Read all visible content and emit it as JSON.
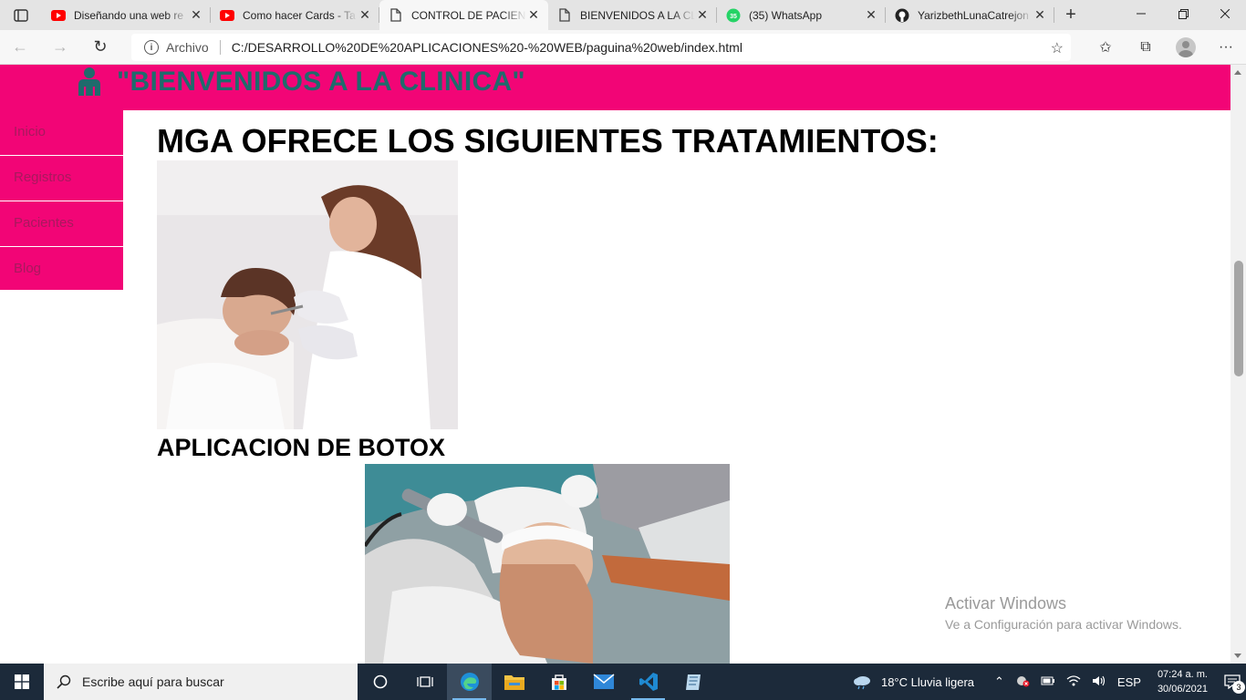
{
  "browser": {
    "tabs": [
      {
        "title": "Diseñando una web re",
        "favicon": "youtube-icon",
        "active": false
      },
      {
        "title": "Como hacer Cards - Ta",
        "favicon": "youtube-icon",
        "active": false
      },
      {
        "title": "CONTROL DE PACIENT",
        "favicon": "document-icon",
        "active": true
      },
      {
        "title": "BIENVENIDOS A LA CL",
        "favicon": "document-icon",
        "active": false
      },
      {
        "title": "(35) WhatsApp",
        "favicon": "whatsapp-icon",
        "active": false
      },
      {
        "title": "YarizbethLunaCatrejon",
        "favicon": "github-icon",
        "active": false
      }
    ],
    "whatsapp_badge": "35",
    "address": {
      "scheme_label": "Archivo",
      "url": "C:/DESARROLLO%20DE%20APLICACIONES%20-%20WEB/paguina%20web/index.html"
    }
  },
  "page": {
    "site_title": "\"BIENVENIDOS A LA CLINICA\"",
    "nav": [
      {
        "label": "Inicio"
      },
      {
        "label": "Registros"
      },
      {
        "label": "Pacientes"
      },
      {
        "label": "Blog"
      }
    ],
    "heading": "MGA OFRECE LOS SIGUIENTES TRATAMIENTOS:",
    "treatments": [
      {
        "caption": "APLICACION DE BOTOX"
      }
    ],
    "watermark": {
      "line1": "Activar Windows",
      "line2": "Ve a Configuración para activar Windows."
    }
  },
  "taskbar": {
    "search_placeholder": "Escribe aquí para buscar",
    "weather": "18°C  Lluvia ligera",
    "language": "ESP",
    "time": "07:24 a. m.",
    "date": "30/06/2021",
    "notification_count": "3"
  },
  "colors": {
    "brand_pink": "#f20576",
    "title_teal": "#1f6b6c",
    "taskbar": "#1c2a3a"
  }
}
